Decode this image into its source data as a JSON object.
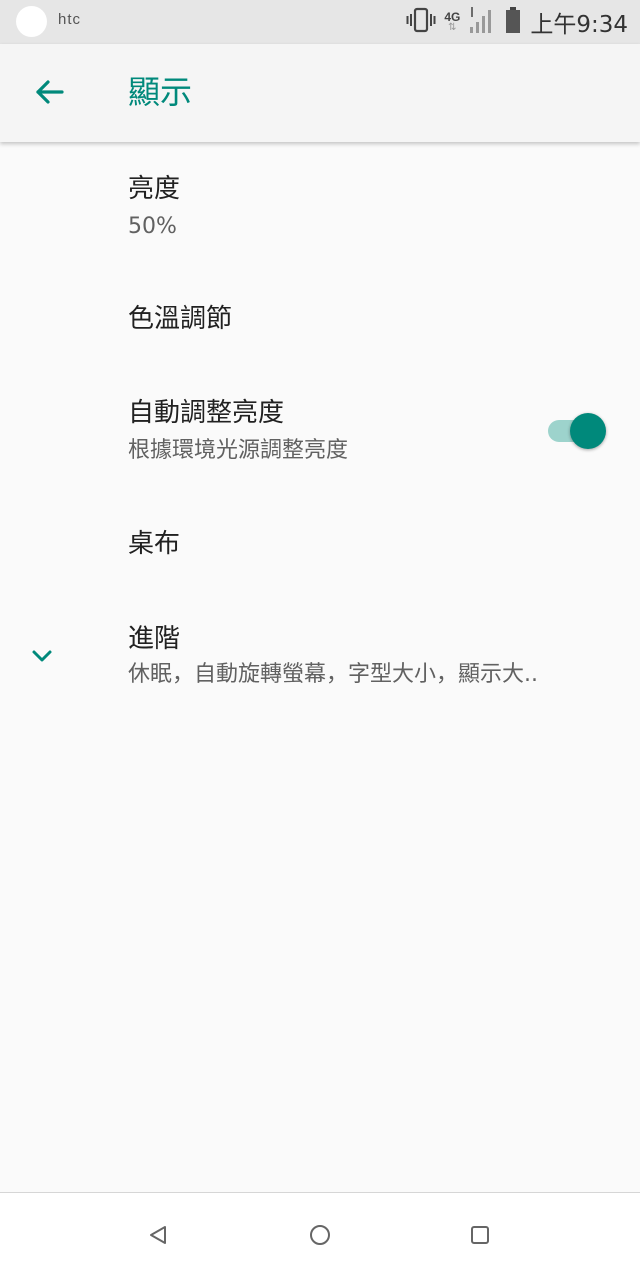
{
  "status_bar": {
    "brand": "htc",
    "network": "4G",
    "time": "上午9:34",
    "icons": [
      "vibrate-icon",
      "network-4g-icon",
      "signal-icon",
      "battery-icon"
    ]
  },
  "app_bar": {
    "back_icon": "arrow-left-icon",
    "title": "顯示"
  },
  "settings": {
    "brightness": {
      "title": "亮度",
      "summary": "50%"
    },
    "color_temp": {
      "title": "色溫調節"
    },
    "auto_brightness": {
      "title": "自動調整亮度",
      "summary": "根據環境光源調整亮度",
      "enabled": true
    },
    "wallpaper": {
      "title": "桌布"
    },
    "advanced": {
      "title": "進階",
      "summary": "休眠，自動旋轉螢幕，字型大小，顯示大..",
      "icon": "chevron-down-icon"
    }
  },
  "nav_bar": {
    "icons": [
      "back-triangle-icon",
      "home-circle-icon",
      "recents-square-icon"
    ]
  },
  "colors": {
    "accent": "#00897b",
    "accent_track": "#9dd3cc",
    "status_bar_bg": "#e6e6e6",
    "background": "#fafafa"
  }
}
